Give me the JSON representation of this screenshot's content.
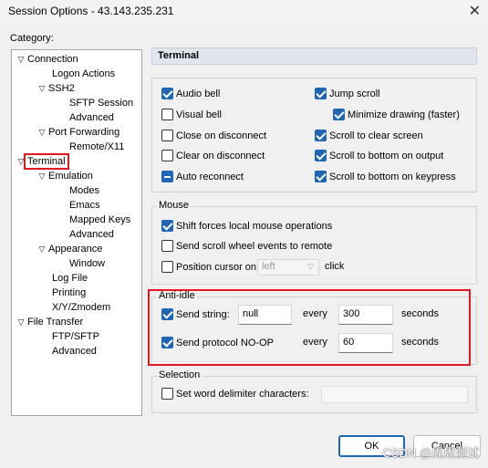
{
  "window": {
    "title": "Session Options - 43.143.235.231",
    "close_glyph": "✕"
  },
  "category": {
    "label": "Category:",
    "tree": [
      {
        "label": "Connection",
        "toggle": "down"
      },
      {
        "label": "Logon Actions",
        "toggle": ""
      },
      {
        "label": "SSH2",
        "toggle": "down"
      },
      {
        "label": "SFTP Session",
        "toggle": ""
      },
      {
        "label": "Advanced",
        "toggle": ""
      },
      {
        "label": "Port Forwarding",
        "toggle": "down"
      },
      {
        "label": "Remote/X11",
        "toggle": ""
      },
      {
        "label": "Terminal",
        "toggle": "down",
        "selected": true
      },
      {
        "label": "Emulation",
        "toggle": "down"
      },
      {
        "label": "Modes",
        "toggle": ""
      },
      {
        "label": "Emacs",
        "toggle": ""
      },
      {
        "label": "Mapped Keys",
        "toggle": ""
      },
      {
        "label": "Advanced",
        "toggle": ""
      },
      {
        "label": "Appearance",
        "toggle": "down"
      },
      {
        "label": "Window",
        "toggle": ""
      },
      {
        "label": "Log File",
        "toggle": ""
      },
      {
        "label": "Printing",
        "toggle": ""
      },
      {
        "label": "X/Y/Zmodem",
        "toggle": ""
      },
      {
        "label": "File Transfer",
        "toggle": "down"
      },
      {
        "label": "FTP/SFTP",
        "toggle": ""
      },
      {
        "label": "Advanced",
        "toggle": ""
      }
    ]
  },
  "panel": {
    "title": "Terminal",
    "options": {
      "audio_bell": {
        "label": "Audio bell",
        "checked": true
      },
      "visual_bell": {
        "label": "Visual bell",
        "checked": false
      },
      "close_on_disconnect": {
        "label": "Close on disconnect",
        "checked": false
      },
      "clear_on_disconnect": {
        "label": "Clear on disconnect",
        "checked": false
      },
      "auto_reconnect": {
        "label": "Auto reconnect",
        "checked": "indeterminate"
      },
      "jump_scroll": {
        "label": "Jump scroll",
        "checked": true
      },
      "minimize_drawing": {
        "label": "Minimize drawing (faster)",
        "checked": true
      },
      "scroll_to_clear": {
        "label": "Scroll to clear screen",
        "checked": true
      },
      "scroll_bottom_output": {
        "label": "Scroll to bottom on output",
        "checked": true
      },
      "scroll_bottom_keypress": {
        "label": "Scroll to bottom on keypress",
        "checked": true
      }
    },
    "mouse": {
      "title": "Mouse",
      "shift_forces": {
        "label": "Shift forces local mouse operations",
        "checked": true
      },
      "send_scroll": {
        "label": "Send scroll wheel events to remote",
        "checked": false
      },
      "position_cursor": {
        "label": "Position cursor on",
        "checked": false
      },
      "position_select": "left",
      "click_label": "click"
    },
    "anti_idle": {
      "title": "Anti-idle",
      "send_string": {
        "label": "Send string:",
        "checked": true,
        "value": "null"
      },
      "send_noop": {
        "label": "Send protocol NO-OP",
        "checked": true
      },
      "every_label": "every",
      "seconds_label": "seconds",
      "string_interval": "300",
      "noop_interval": "60"
    },
    "selection": {
      "title": "Selection",
      "word_delim": {
        "label": "Set word delimiter characters:",
        "checked": false
      }
    }
  },
  "buttons": {
    "ok": "OK",
    "cancel": "Cancel"
  },
  "watermark": "CSDN @周周测试",
  "colors": {
    "accent": "#1f66b3",
    "highlight_red": "#e0191f",
    "header_bg": "#dfe6ee"
  }
}
